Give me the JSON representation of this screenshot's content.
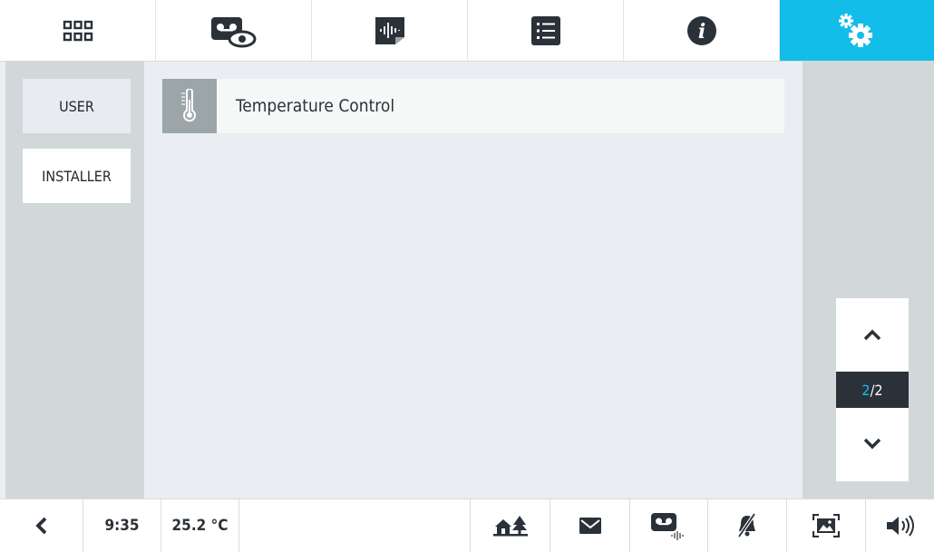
{
  "top_tabs": [
    {
      "name": "apps-grid-icon"
    },
    {
      "name": "answering-machine-view-icon"
    },
    {
      "name": "audio-message-icon"
    },
    {
      "name": "list-icon"
    },
    {
      "name": "info-icon"
    },
    {
      "name": "settings-gears-icon",
      "active": true
    }
  ],
  "side_menu": {
    "user_label": "USER",
    "installer_label": "INSTALLER"
  },
  "list": {
    "items": [
      {
        "label": "Temperature Control",
        "icon": "thermometer-icon"
      }
    ]
  },
  "pager": {
    "current": "2",
    "separator": "/",
    "total": "2"
  },
  "status_bar": {
    "time": "9:35",
    "temperature": "25.2 °C",
    "icons": [
      "back-arrow-icon",
      "home-outdoor-icon",
      "mail-icon",
      "voicemail-audio-icon",
      "bell-muted-icon",
      "picture-frame-icon",
      "volume-icon"
    ]
  },
  "colors": {
    "accent": "#12bde9",
    "dark": "#2b3138",
    "panel": "#d2d8d9",
    "content_bg": "#eaeef2"
  }
}
